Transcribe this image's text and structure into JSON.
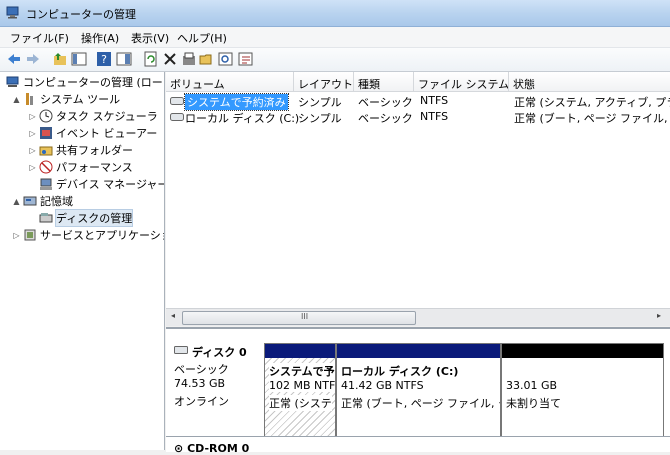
{
  "window": {
    "title": "コンピューターの管理"
  },
  "menu": [
    "ファイル(F)",
    "操作(A)",
    "表示(V)",
    "ヘルプ(H)"
  ],
  "toolbar_icons": [
    "back-icon",
    "forward-icon",
    "up-folder-icon",
    "show-hide-tree-icon",
    "help-icon",
    "panel-icon",
    "refresh-icon",
    "delete-icon",
    "properties-icon",
    "open-icon",
    "search-icon",
    "export-icon"
  ],
  "tree": [
    {
      "label": "コンピューターの管理 (ローカ",
      "expand": "",
      "icon": "computer-management-icon"
    },
    {
      "label": "システム ツール",
      "expand": "▲",
      "icon": "tools-icon"
    },
    {
      "label": "タスク スケジューラ",
      "expand": "▷",
      "icon": "clock-icon"
    },
    {
      "label": "イベント ビューアー",
      "expand": "▷",
      "icon": "event-viewer-icon"
    },
    {
      "label": "共有フォルダー",
      "expand": "▷",
      "icon": "shared-folder-icon"
    },
    {
      "label": "パフォーマンス",
      "expand": "▷",
      "icon": "performance-icon"
    },
    {
      "label": "デバイス マネージャー",
      "expand": "",
      "icon": "device-manager-icon"
    },
    {
      "label": "記憶域",
      "expand": "▲",
      "icon": "storage-icon"
    },
    {
      "label": "ディスクの管理",
      "expand": "",
      "icon": "disk-management-icon"
    },
    {
      "label": "サービスとアプリケーショ",
      "expand": "▷",
      "icon": "services-icon"
    }
  ],
  "columns": [
    "ボリューム",
    "レイアウト",
    "種類",
    "ファイル システム",
    "状態"
  ],
  "volumes": [
    {
      "name": "システムで予約済み",
      "layout": "シンプル",
      "type": "ベーシック",
      "fs": "NTFS",
      "status": "正常 (システム, アクティブ, プラ"
    },
    {
      "name": "ローカル ディスク (C:)",
      "layout": "シンプル",
      "type": "ベーシック",
      "fs": "NTFS",
      "status": "正常 (ブート, ページ ファイル, ク"
    }
  ],
  "scroll_grip": "III",
  "disk0": {
    "name": "ディスク 0",
    "type": "ベーシック",
    "size": "74.53 GB",
    "state": "オンライン",
    "partitions": [
      {
        "title": "システムで予",
        "detail": "102 MB NTF",
        "status": "正常 (システ",
        "band": "#0a1a7a"
      },
      {
        "title": "ローカル ディスク (C:)",
        "detail": "41.42 GB NTFS",
        "status": "正常 (ブート, ページ ファイル, ク",
        "band": "#0a1a7a"
      },
      {
        "title": "",
        "detail": "33.01 GB",
        "status": "未割り当て",
        "band": "#000000"
      }
    ]
  },
  "cdrom": {
    "name": "CD-ROM 0"
  }
}
